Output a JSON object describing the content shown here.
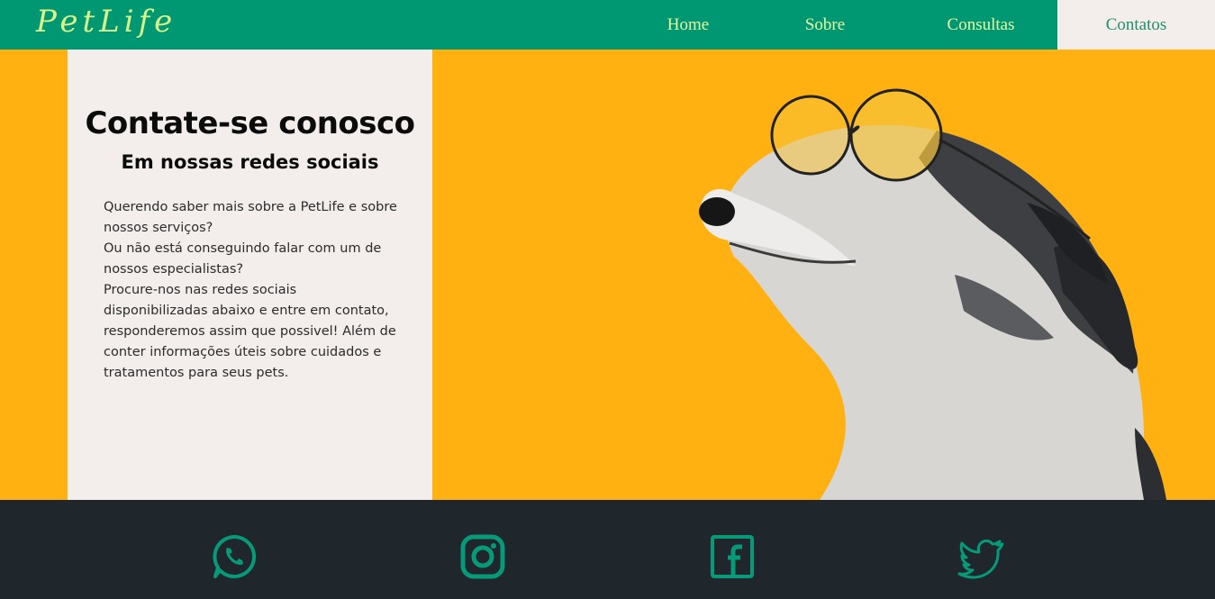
{
  "brand": {
    "name": "PetLife"
  },
  "nav": {
    "items": [
      {
        "label": "Home"
      },
      {
        "label": "Sobre"
      },
      {
        "label": "Consultas"
      },
      {
        "label": "Contatos",
        "active": true
      }
    ]
  },
  "contact": {
    "title": "Contate-se conosco",
    "subtitle": "Em nossas redes sociais",
    "paragraphs": [
      "Querendo saber mais sobre a PetLife e sobre nossos serviços?",
      "Ou não está conseguindo falar com um de nossos especialistas?",
      "Procure-nos nas redes sociais disponibilizadas abaixo e entre em contato, responderemos assim que possivel! Além de conter informações úteis sobre cuidados e tratamentos para seus pets."
    ]
  },
  "social": {
    "icons": [
      "whatsapp-icon",
      "instagram-icon",
      "facebook-icon",
      "twitter-icon"
    ]
  },
  "colors": {
    "header": "#009872",
    "accent_text": "#e9f7a0",
    "background": "#ffb111",
    "card": "#f3eeeb",
    "footer": "#1f262c",
    "icon": "#079a78"
  }
}
